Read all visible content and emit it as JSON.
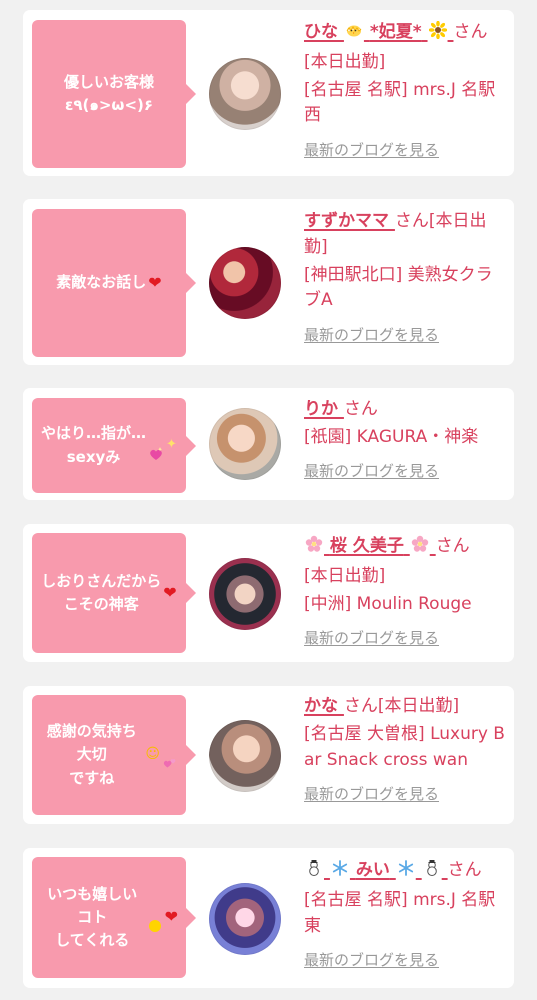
{
  "cards": [
    {
      "bubble_text": "優しいお客様\nε٩(๑>ω<)۶",
      "bubble_icons": [],
      "name_prefix_icons": [],
      "name": "ひな",
      "name_mid_icon": "hatching-chick-icon",
      "name_suffix_text": "*妃夏*",
      "name_suffix_icons": [
        "sunflower-icon"
      ],
      "suffix": "さん",
      "detail_1": "[本日出勤]",
      "detail_2": "[名古屋 名駅] mrs.J 名駅西",
      "blog": "最新のブログを見る"
    },
    {
      "bubble_text": "素敵なお話し",
      "bubble_icons": [
        "red-heart-icon"
      ],
      "name_prefix_icons": [],
      "name": "すずかママ",
      "name_mid_icon": "",
      "name_suffix_text": "",
      "name_suffix_icons": [],
      "suffix": "さん[本日出勤]",
      "detail_1": "[神田駅北口] 美熟女クラブA",
      "detail_2": "",
      "blog": "最新のブログを見る"
    },
    {
      "bubble_text": "やはり…指が…\nsexyみ",
      "bubble_icons": [
        "sparkling-heart-icon",
        "sparkles-icon"
      ],
      "name_prefix_icons": [],
      "name": "りか",
      "name_mid_icon": "",
      "name_suffix_text": "",
      "name_suffix_icons": [],
      "suffix": "さん",
      "detail_1": "[祇園] KAGURA・神楽",
      "detail_2": "",
      "blog": "最新のブログを見る"
    },
    {
      "bubble_text": "しおりさんだから\nこその神客",
      "bubble_icons": [
        "red-heart-icon"
      ],
      "name_prefix_icons": [
        "cherry-blossom-icon"
      ],
      "name": "桜 久美子",
      "name_mid_icon": "",
      "name_suffix_text": "",
      "name_suffix_icons": [
        "cherry-blossom-icon"
      ],
      "suffix": "さん",
      "detail_1": "[本日出勤]",
      "detail_2": "[中洲] Moulin Rouge",
      "blog": "最新のブログを見る"
    },
    {
      "bubble_text": "感謝の気持ち大切\nですね",
      "bubble_icons": [
        "smiling-face-icon",
        "two-hearts-icon"
      ],
      "name_prefix_icons": [],
      "name": "かな",
      "name_mid_icon": "",
      "name_suffix_text": "",
      "name_suffix_icons": [],
      "suffix": "さん[本日出勤]",
      "detail_1": "[名古屋 大曽根] Luxury Bar Snack cross wan",
      "detail_2": "",
      "blog": "最新のブログを見る"
    },
    {
      "bubble_text": "いつも嬉しいコト\nしてくれる",
      "bubble_icons": [
        "yellow-dot-icon",
        "red-heart-icon"
      ],
      "name_prefix_icons": [
        "snowman-icon",
        "snowflake-icon"
      ],
      "name": "みい",
      "name_mid_icon": "",
      "name_suffix_text": "",
      "name_suffix_icons": [
        "snowflake-icon",
        "snowman-icon"
      ],
      "suffix": "さん",
      "detail_1": "[名古屋 名駅] mrs.J 名駅東",
      "detail_2": "",
      "blog": "最新のブログを見る"
    }
  ],
  "colors": {
    "background": "#f1f1f1",
    "card": "#ffffff",
    "accent": "#d8415e",
    "bubble": "#f89aad",
    "link_gray": "#999999"
  }
}
